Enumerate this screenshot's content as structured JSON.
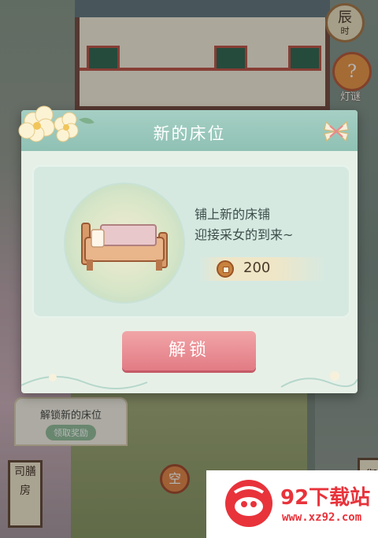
{
  "hud": {
    "time_char": "辰",
    "time_sub": "时",
    "lantern_char": "?",
    "lantern_label": "灯谜"
  },
  "background": {
    "left_banner_title": "解锁新的床位",
    "left_banner_button": "领取奖励",
    "kitchen_sign": "司膳房",
    "empty_slot": "空",
    "right_sign": "御"
  },
  "dialog": {
    "title": "新的床位",
    "description_line1": "铺上新的床铺",
    "description_line2": "迎接采女的到来~",
    "cost_value": "200",
    "cost_icon": "copper-coin-icon",
    "unlock_label": "解锁"
  },
  "watermark": {
    "name": "92下载站",
    "url": "www.xz92.com"
  },
  "colors": {
    "header": "#8fc1b4",
    "button": "#e27b84",
    "panel": "#d6e9e1",
    "watermark_red": "#e8333b"
  }
}
